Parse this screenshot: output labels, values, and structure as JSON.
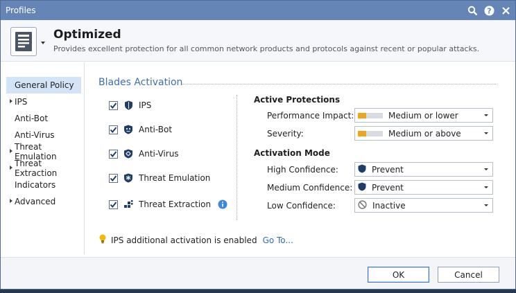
{
  "window": {
    "title": "Profiles"
  },
  "titlebar_icons": [
    "search-icon",
    "help-icon",
    "close-icon"
  ],
  "header": {
    "title": "Optimized",
    "description": "Provides excellent protection for all common network products and protocols against recent or popular attacks."
  },
  "sidebar": {
    "items": [
      {
        "label": "General Policy",
        "expandable": false,
        "selected": true
      },
      {
        "label": "IPS",
        "expandable": true,
        "selected": false
      },
      {
        "label": "Anti-Bot",
        "expandable": false,
        "selected": false
      },
      {
        "label": "Anti-Virus",
        "expandable": false,
        "selected": false
      },
      {
        "label": "Threat Emulation",
        "expandable": true,
        "selected": false
      },
      {
        "label": "Threat Extraction",
        "expandable": true,
        "selected": false
      },
      {
        "label": "Indicators",
        "expandable": false,
        "selected": false
      },
      {
        "label": "Advanced",
        "expandable": true,
        "selected": false
      }
    ]
  },
  "blades_section": {
    "title": "Blades Activation"
  },
  "blades": [
    {
      "label": "IPS",
      "checked": true,
      "icon": "ips-shield-icon"
    },
    {
      "label": "Anti-Bot",
      "checked": true,
      "icon": "anti-bot-icon"
    },
    {
      "label": "Anti-Virus",
      "checked": true,
      "icon": "anti-virus-icon"
    },
    {
      "label": "Threat Emulation",
      "checked": true,
      "icon": "threat-emulation-icon"
    },
    {
      "label": "Threat Extraction",
      "checked": true,
      "icon": "threat-extraction-icon"
    }
  ],
  "active_protections": {
    "title": "Active Protections",
    "performance_impact": {
      "label": "Performance Impact:",
      "value": "Medium or lower",
      "level": 0.33
    },
    "severity": {
      "label": "Severity:",
      "value": "Medium or above",
      "level": 0.33
    }
  },
  "activation_mode": {
    "title": "Activation Mode",
    "high": {
      "label": "High Confidence:",
      "value": "Prevent",
      "icon": "prevent-shield-icon"
    },
    "medium": {
      "label": "Medium Confidence:",
      "value": "Prevent",
      "icon": "prevent-shield-icon"
    },
    "low": {
      "label": "Low Confidence:",
      "value": "Inactive",
      "icon": "inactive-icon"
    }
  },
  "notice": {
    "text": "IPS additional activation is enabled",
    "link": "Go To..."
  },
  "footer": {
    "ok": "OK",
    "cancel": "Cancel"
  },
  "colors": {
    "titlebar": "#6585b6",
    "accent_blue": "#3d6fb0",
    "meter_orange": "#f0a41c",
    "meter_gray": "#d9dde3",
    "shield_navy": "#1f3d6b"
  }
}
